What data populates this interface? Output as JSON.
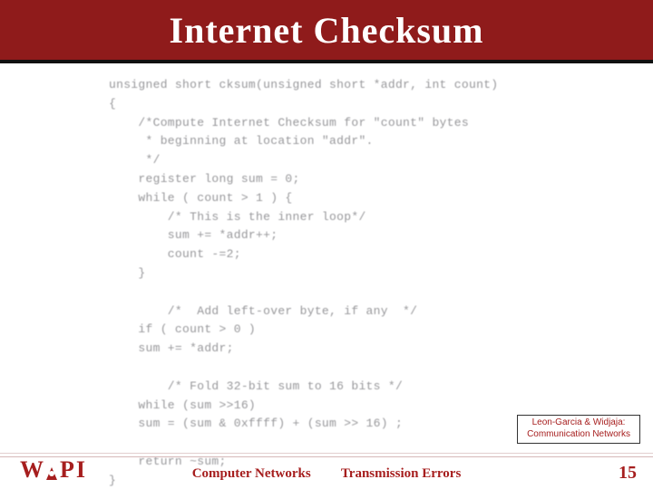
{
  "title": "Internet Checksum",
  "code": "unsigned short cksum(unsigned short *addr, int count)\n{\n    /*Compute Internet Checksum for \"count\" bytes\n     * beginning at location \"addr\".\n     */\n    register long sum = 0;\n    while ( count > 1 ) {\n        /* This is the inner loop*/\n        sum += *addr++;\n        count -=2;\n    }\n\n        /*  Add left-over byte, if any  */\n    if ( count > 0 )\n    sum += *addr;\n\n        /* Fold 32-bit sum to 16 bits */\n    while (sum >>16)\n    sum = (sum & 0xffff) + (sum >> 16) ;\n\n    return ~sum;\n}",
  "citation": {
    "line1": "Leon-Garcia & Widjaja:",
    "line2": "Communication Networks"
  },
  "footer": {
    "left_logo_text": "WPI",
    "center_left": "Computer Networks",
    "center_right": "Transmission Errors",
    "page_number": "15"
  }
}
